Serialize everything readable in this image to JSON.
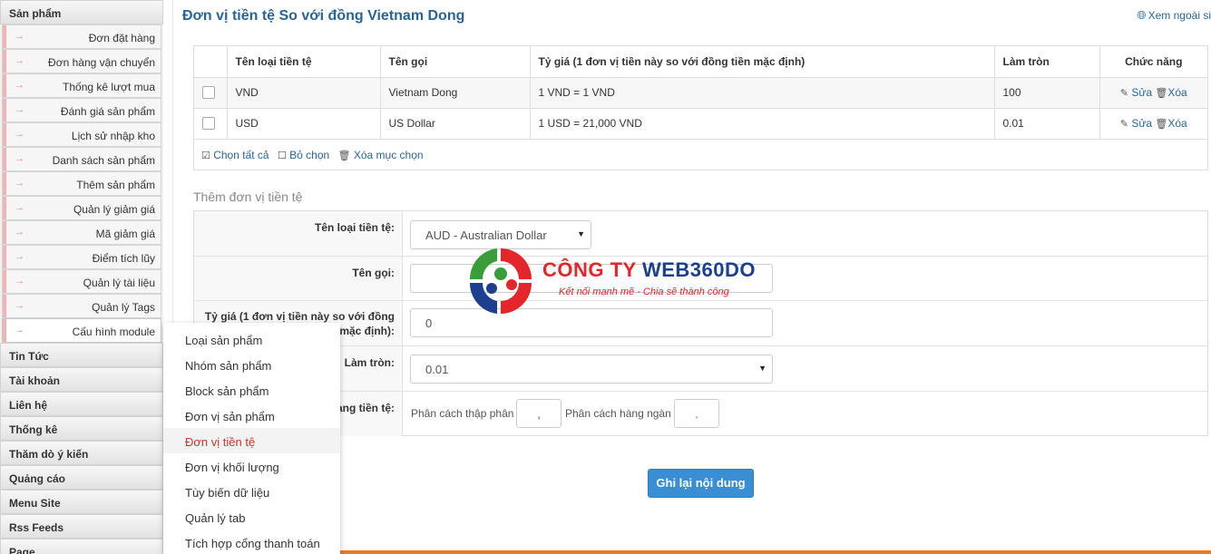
{
  "sidebar": {
    "header": "Sản phẩm",
    "sub_items": [
      {
        "label": "Đơn đặt hàng"
      },
      {
        "label": "Đơn hàng vận chuyển"
      },
      {
        "label": "Thống kê lượt mua"
      },
      {
        "label": "Đánh giá sản phẩm"
      },
      {
        "label": "Lịch sử nhập kho"
      },
      {
        "label": "Danh sách sản phẩm"
      },
      {
        "label": "Thêm sản phẩm"
      },
      {
        "label": "Quản lý giảm giá"
      },
      {
        "label": "Mã giảm giá"
      },
      {
        "label": "Điểm tích lũy"
      },
      {
        "label": "Quản lý tài liệu"
      },
      {
        "label": "Quản lý Tags"
      },
      {
        "label": "Cấu hình module"
      }
    ],
    "arrow": "→",
    "main_items": [
      {
        "label": "Tin Tức"
      },
      {
        "label": "Tài khoản"
      },
      {
        "label": "Liên hệ"
      },
      {
        "label": "Thống kê"
      },
      {
        "label": "Thăm dò ý kiến"
      },
      {
        "label": "Quảng cáo"
      },
      {
        "label": "Menu Site"
      },
      {
        "label": "Rss Feeds"
      },
      {
        "label": "Page"
      }
    ]
  },
  "submenu": {
    "items": [
      {
        "label": "Loại sản phẩm"
      },
      {
        "label": "Nhóm sản phẩm"
      },
      {
        "label": "Block sản phẩm"
      },
      {
        "label": "Đơn vị sản phẩm"
      },
      {
        "label": "Đơn vị tiền tệ"
      },
      {
        "label": "Đơn vị khối lượng"
      },
      {
        "label": "Tùy biến dữ liệu"
      },
      {
        "label": "Quản lý tab"
      },
      {
        "label": "Tích hợp cổng thanh toán"
      }
    ],
    "selected_index": 4
  },
  "page": {
    "title": "Đơn vị tiền tệ So với đồng Vietnam Dong",
    "view_link": "Xem ngoài si"
  },
  "table": {
    "headers": [
      "Tên loại tiền tệ",
      "Tên gọi",
      "Tỷ giá (1 đơn vị tiền này so với đồng tiền mặc định)",
      "Làm tròn",
      "Chức năng"
    ],
    "rows": [
      {
        "code": "VND",
        "name": "Vietnam Dong",
        "rate": "1 VND = 1 VND",
        "round": "100"
      },
      {
        "code": "USD",
        "name": "US Dollar",
        "rate": "1 USD = 21,000 VND",
        "round": "0.01"
      }
    ],
    "edit_label": "Sửa",
    "delete_label": "Xóa",
    "select_all": "Chọn tất cả",
    "deselect": "Bỏ chọn",
    "delete_selected": "Xóa mục chọn"
  },
  "form": {
    "title": "Thêm đơn vị tiền tệ",
    "currency_label": "Tên loại tiền tệ:",
    "currency_value": "AUD - Australian Dollar",
    "name_label": "Tên gọi:",
    "name_value": "",
    "rate_label_1": "Tỷ giá (1 đơn vị tiền này so với đồng",
    "rate_label_2": "mặc định):",
    "rate_value": "0",
    "round_label": "Làm tròn:",
    "round_value": "0.01",
    "format_label": "ạng tiền tệ:",
    "decimal_sep_label": "Phân cách thập phân",
    "decimal_sep_value": ",",
    "thousand_sep_label": "Phân cách hàng ngàn",
    "thousand_sep_value": ".",
    "save_label": "Ghi lại nội dung"
  },
  "logo": {
    "name_red": "CÔNG TY ",
    "name_blue": "WEB360DO",
    "slogan": "Kết nối mạnh mẽ - Chia sẽ thành công"
  },
  "colors": {
    "accent": "#2a6496",
    "button": "#3a8fd4",
    "logo_red": "#e2262b",
    "logo_blue": "#1d3f8f",
    "bottom_bar": "#e87b2a"
  }
}
